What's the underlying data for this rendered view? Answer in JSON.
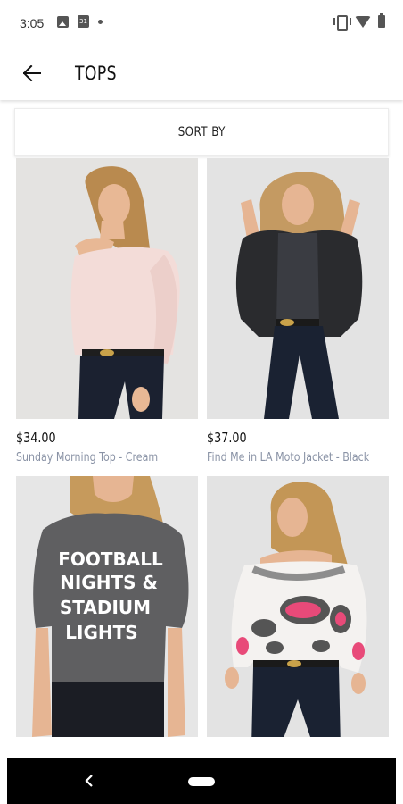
{
  "status_bar": {
    "time": "3:05",
    "left_icons": [
      "image-icon",
      "calendar-icon",
      "dot-icon"
    ],
    "calendar_day": "31",
    "right_icons": [
      "vibrate-icon",
      "wifi-icon",
      "battery-icon"
    ]
  },
  "app_bar": {
    "title": "TOPS",
    "back_icon": "arrow-left-icon"
  },
  "sort": {
    "label": "SORT BY"
  },
  "products": [
    {
      "price": "$34.00",
      "name": "Sunday Morning Top - Cream"
    },
    {
      "price": "$37.00",
      "name": "Find Me in LA Moto Jacket - Black"
    },
    {
      "shirt_text": [
        "FOOTBALL",
        "NIGHTS &",
        "STADIUM",
        "LIGHTS"
      ]
    },
    {}
  ],
  "colors": {
    "background": "#ffffff",
    "text": "#111111",
    "product_name": "#8a93a6",
    "nav_bar": "#000000"
  }
}
